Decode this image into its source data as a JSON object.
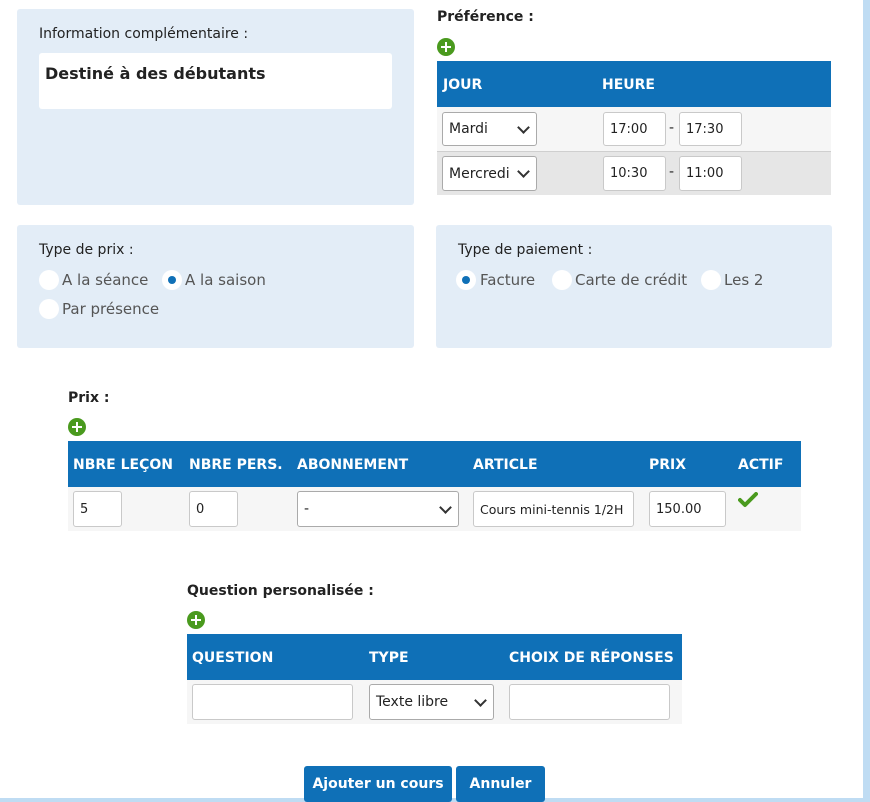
{
  "info": {
    "label": "Information complémentaire :",
    "value": "Destiné à des débutants"
  },
  "preference": {
    "title": "Préférence :",
    "add_icon": "plus-circle-icon",
    "columns": [
      "JOUR",
      "HEURE"
    ],
    "rows": [
      {
        "day": "Mardi",
        "start": "17:00",
        "end": "17:30"
      },
      {
        "day": "Mercredi",
        "start": "10:30",
        "end": "11:00"
      }
    ],
    "separator": "-"
  },
  "price_type": {
    "label": "Type de prix :",
    "options": [
      "A la séance",
      "A la saison",
      "Par présence"
    ],
    "selected": "A la saison"
  },
  "payment_type": {
    "label": "Type de paiement :",
    "options": [
      "Facture",
      "Carte de crédit",
      "Les 2"
    ],
    "selected": "Facture"
  },
  "prix": {
    "title": "Prix :",
    "columns": [
      "NBRE LEÇON",
      "NBRE PERS.",
      "ABONNEMENT",
      "ARTICLE",
      "PRIX",
      "ACTIF"
    ],
    "row": {
      "lessons": "5",
      "persons": "0",
      "subscription": "-",
      "article": "Cours mini-tennis 1/2H",
      "price": "150.00",
      "active_icon": "checkmark-icon"
    }
  },
  "question": {
    "title": "Question personalisée :",
    "columns": [
      "QUESTION",
      "TYPE",
      "CHOIX DE RÉPONSES"
    ],
    "row": {
      "question": "",
      "type": "Texte libre",
      "choices": ""
    }
  },
  "actions": {
    "submit": "Ajouter un cours",
    "cancel": "Annuler"
  },
  "colors": {
    "header_blue": "#0f70b7",
    "panel_bg": "#e3edf7",
    "add_green": "#4a9a1e"
  }
}
